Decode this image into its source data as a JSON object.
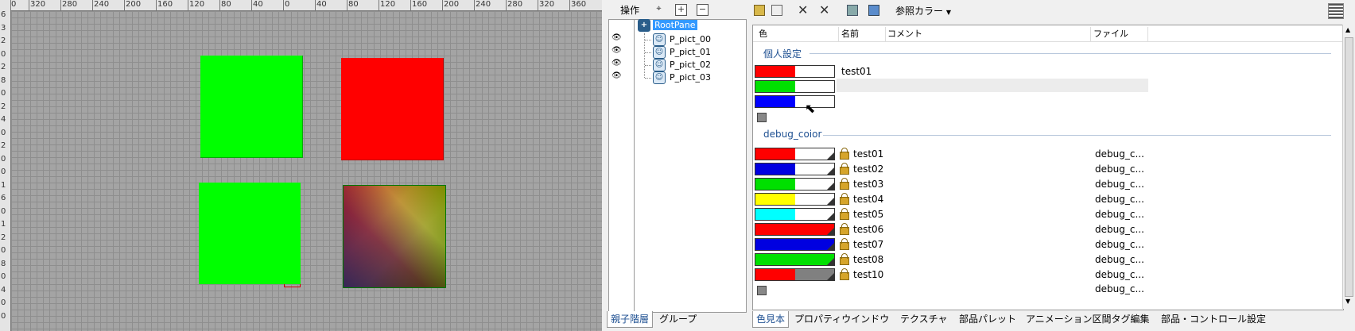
{
  "canvas": {
    "top_ruler": [
      "0",
      "320",
      "280",
      "240",
      "200",
      "160",
      "120",
      "80",
      "40",
      "0",
      "40",
      "80",
      "120",
      "160",
      "200",
      "240",
      "280",
      "320",
      "360"
    ],
    "left_ruler": [
      "6",
      "3",
      "2",
      "0",
      "2",
      "8",
      "0",
      "2",
      "4",
      "0",
      "2",
      "0",
      "0",
      "1",
      "6",
      "0",
      "1",
      "2",
      "0",
      "8",
      "0",
      "4",
      "0",
      "0"
    ]
  },
  "hierarchy": {
    "toolbar_label": "操作",
    "root": "RootPane",
    "children": [
      "P_pict_00",
      "P_pict_01",
      "P_pict_02",
      "P_pict_03"
    ],
    "tabs": [
      "親子階層",
      "グループ"
    ]
  },
  "colors_panel": {
    "ref_color_label": "参照カラー",
    "columns": [
      "色",
      "名前",
      "コメント",
      "ファイル"
    ],
    "personal_section": "個人設定",
    "personal_rows": [
      {
        "name": "test01",
        "color": "#ff0000"
      },
      {
        "name": "",
        "color": "#00e000"
      },
      {
        "name": "",
        "color": "#0000ff"
      }
    ],
    "debug_section": "debug_coior",
    "debug_rows": [
      {
        "name": "test01",
        "file": "debug_c...",
        "color": "#ff0000",
        "color2": ""
      },
      {
        "name": "test02",
        "file": "debug_c...",
        "color": "#0000e0",
        "color2": ""
      },
      {
        "name": "test03",
        "file": "debug_c...",
        "color": "#00e000",
        "color2": ""
      },
      {
        "name": "test04",
        "file": "debug_c...",
        "color": "#ffff00",
        "color2": ""
      },
      {
        "name": "test05",
        "file": "debug_c...",
        "color": "#00ffff",
        "color2": ""
      },
      {
        "name": "test06",
        "file": "debug_c...",
        "color": "#ff0000",
        "color2": "#ff0000"
      },
      {
        "name": "test07",
        "file": "debug_c...",
        "color": "#0000e0",
        "color2": "#0000e0"
      },
      {
        "name": "test08",
        "file": "debug_c...",
        "color": "#00e000",
        "color2": "#00e000"
      },
      {
        "name": "test10",
        "file": "debug_c...",
        "color": "#ff0000",
        "color2": "#808080"
      }
    ],
    "last_file": "debug_c...",
    "tabs": [
      "色見本",
      "プロパティウインドウ",
      "テクスチャ",
      "部品パレット",
      "アニメーション区間タグ編集",
      "部品・コントロール設定"
    ]
  }
}
